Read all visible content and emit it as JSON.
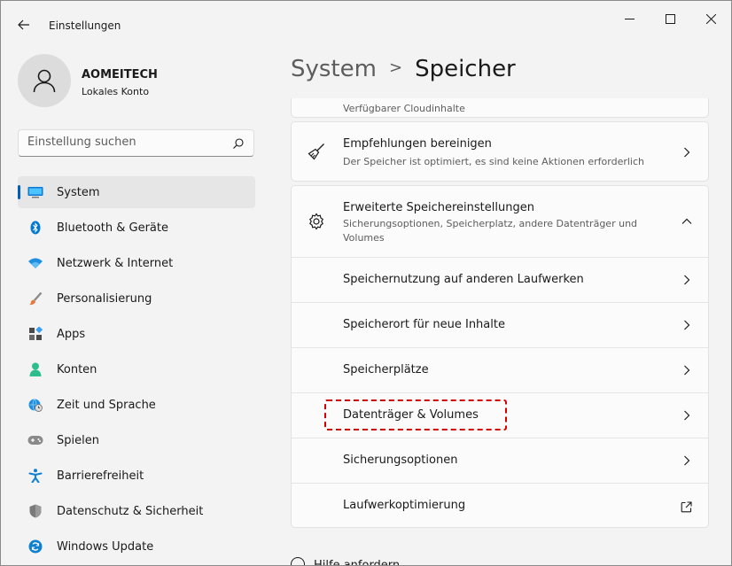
{
  "titlebar": {
    "title": "Einstellungen"
  },
  "profile": {
    "name": "AOMEITECH",
    "account_type": "Lokales Konto"
  },
  "search": {
    "placeholder": "Einstellung suchen"
  },
  "nav": {
    "items": [
      {
        "label": "System",
        "icon": "system-icon",
        "active": true
      },
      {
        "label": "Bluetooth & Geräte",
        "icon": "bluetooth-icon"
      },
      {
        "label": "Netzwerk & Internet",
        "icon": "wifi-icon"
      },
      {
        "label": "Personalisierung",
        "icon": "brush-icon"
      },
      {
        "label": "Apps",
        "icon": "apps-icon"
      },
      {
        "label": "Konten",
        "icon": "person-icon"
      },
      {
        "label": "Zeit und Sprache",
        "icon": "globe-clock-icon"
      },
      {
        "label": "Spielen",
        "icon": "gamepad-icon"
      },
      {
        "label": "Barrierefreiheit",
        "icon": "accessibility-icon"
      },
      {
        "label": "Datenschutz & Sicherheit",
        "icon": "shield-icon"
      },
      {
        "label": "Windows Update",
        "icon": "update-icon"
      }
    ]
  },
  "header": {
    "parent": "System",
    "separator": ">",
    "current": "Speicher"
  },
  "cards": {
    "partial_desc": "Verfügbarer Cloudinhalte",
    "cleanup": {
      "title": "Empfehlungen bereinigen",
      "desc": "Der Speicher ist optimiert, es sind keine Aktionen erforderlich"
    },
    "advanced": {
      "title": "Erweiterte Speichereinstellungen",
      "desc": "Sicherungsoptionen, Speicherplatz, andere Datenträger und Volumes",
      "expanded": true,
      "items": [
        {
          "label": "Speichernutzung auf anderen Laufwerken"
        },
        {
          "label": "Speicherort für neue Inhalte"
        },
        {
          "label": "Speicherplätze"
        },
        {
          "label": "Datenträger & Volumes",
          "highlighted": true
        },
        {
          "label": "Sicherungsoptionen"
        },
        {
          "label": "Laufwerkoptimierung",
          "external": true
        }
      ]
    }
  },
  "footer": {
    "help_label": "Hilfe anfordern"
  },
  "colors": {
    "accent": "#005fb8",
    "highlight": "#d40000",
    "background": "#f3f3f3"
  }
}
